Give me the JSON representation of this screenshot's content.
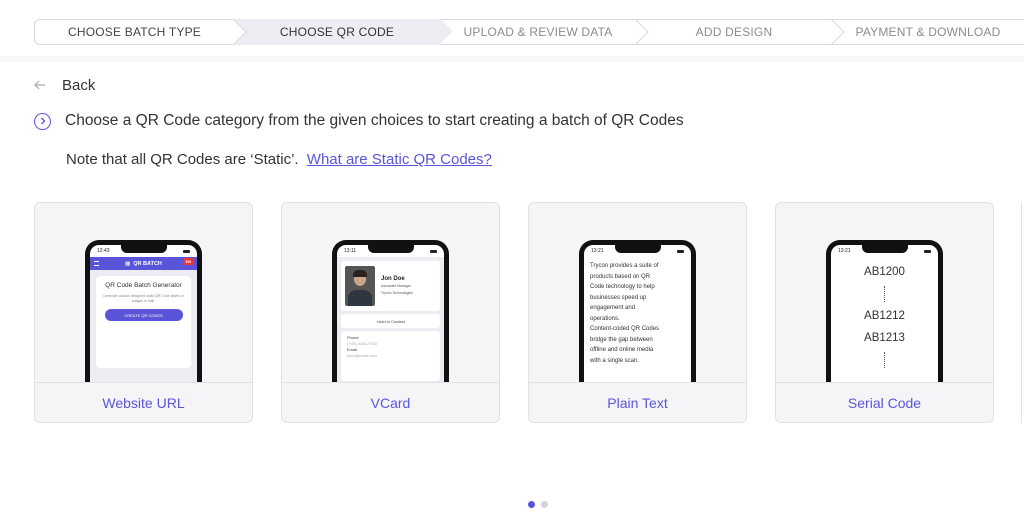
{
  "stepper": {
    "steps": [
      {
        "label": "CHOOSE BATCH TYPE",
        "state": "done"
      },
      {
        "label": "CHOOSE QR CODE",
        "state": "active"
      },
      {
        "label": "UPLOAD & REVIEW DATA",
        "state": "upcoming"
      },
      {
        "label": "ADD DESIGN",
        "state": "upcoming"
      },
      {
        "label": "PAYMENT & DOWNLOAD",
        "state": "upcoming"
      }
    ]
  },
  "back": {
    "label": "Back",
    "icon": "arrow-left-icon"
  },
  "instruction": {
    "text": "Choose a QR Code category from the given choices to start creating a batch of QR Codes",
    "icon": "chevron-right-circle-icon"
  },
  "note": {
    "text": "Note that all QR Codes are ‘Static’.",
    "link": "What are Static QR Codes?"
  },
  "colors": {
    "accent": "#5a55d8",
    "active_step_bg": "#ededf4",
    "card_bg": "#f5f5f7"
  },
  "cards": [
    {
      "label": "Website URL",
      "phone": {
        "time": "12:43",
        "brand": "QR BATCH",
        "lang": "EN",
        "title": "QR Code Batch Generator",
        "desc": "Generate custom designed static QR Code labels or images in bulk.",
        "button": "CREATE QR CODES"
      }
    },
    {
      "label": "VCard",
      "phone": {
        "time": "13:11",
        "name": "Jon Doe",
        "role": "Associate Manager",
        "company": "Trycon Technologies",
        "add_contact": "+Add to Contact",
        "phone_label": "Phone",
        "phone_value": "(+00)-4445-7460",
        "email_label": "Email",
        "email_value": "jdoe@email.com"
      }
    },
    {
      "label": "Plain Text",
      "phone": {
        "time": "13:21",
        "lines": [
          "Trycon provides a suite of",
          "products based on QR",
          "Code technology to help",
          "businesses speed up",
          "engagement and",
          "operations.",
          "Content-coded QR Codes",
          "bridge the gap between",
          "offline and online media",
          "with a single scan."
        ]
      }
    },
    {
      "label": "Serial Code",
      "phone": {
        "time": "13:21",
        "codes": [
          "AB1200",
          "AB1212",
          "AB1213"
        ]
      }
    }
  ],
  "pagination": {
    "total": 2,
    "current": 1
  }
}
